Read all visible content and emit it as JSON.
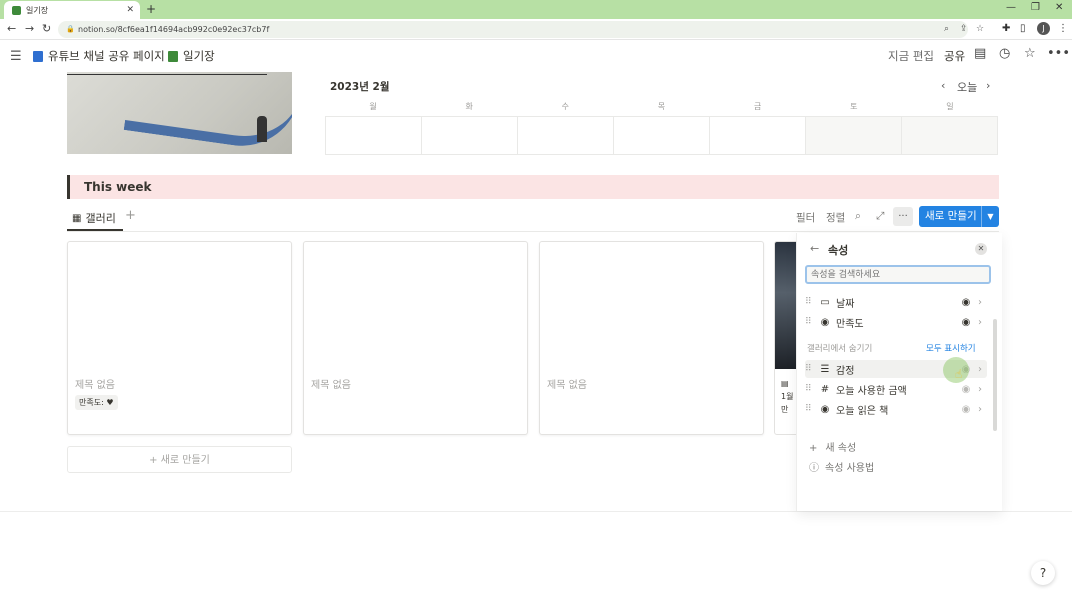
{
  "browser": {
    "tab_title": "일기장",
    "url": "notion.so/8cf6ea1f14694acb992c0e92ec37cb7f",
    "profile_initial": "J"
  },
  "header": {
    "breadcrumb_parent": "유튜브 채널 공유 페이지",
    "breadcrumb_sep": "/",
    "breadcrumb_current": "일기장",
    "edit_label": "지금 편집",
    "share_label": "공유"
  },
  "calendar": {
    "title": "2023년 2월",
    "today_label": "오늘",
    "weekdays": [
      "월",
      "화",
      "수",
      "목",
      "금",
      "토",
      "일"
    ]
  },
  "section": {
    "title": "This week"
  },
  "view": {
    "tab_label": "갤러리",
    "filter_label": "필터",
    "sort_label": "정렬",
    "more_label": "···",
    "new_label": "새로 만들기"
  },
  "cards": [
    {
      "title": "제목 없음",
      "tag": "만족도: ♥"
    },
    {
      "title": "제목 없음"
    },
    {
      "title": "제목 없음"
    }
  ],
  "card4": {
    "line1": "1월",
    "line2": "만"
  },
  "add_new_label": "+ 새로 만들기",
  "panel": {
    "title": "속성",
    "search_placeholder": "속성을 검색하세요",
    "visible": [
      {
        "label": "날짜",
        "icon": "calendar-icon"
      },
      {
        "label": "만족도",
        "icon": "select-icon"
      }
    ],
    "hidden_section_label": "갤러리에서 숨기기",
    "show_all_label": "모두 표시하기",
    "hidden": [
      {
        "label": "감정",
        "icon": "list-icon"
      },
      {
        "label": "오늘 사용한 금액",
        "icon": "number-icon"
      },
      {
        "label": "오늘 읽은 책",
        "icon": "select-icon"
      }
    ],
    "new_property_label": "새 속성",
    "help_label": "속성 사용법"
  },
  "help_button": "?",
  "colors": {
    "accent": "#2383e2",
    "tab_bar": "#b7e0a4",
    "callout": "#fbe4e4"
  }
}
